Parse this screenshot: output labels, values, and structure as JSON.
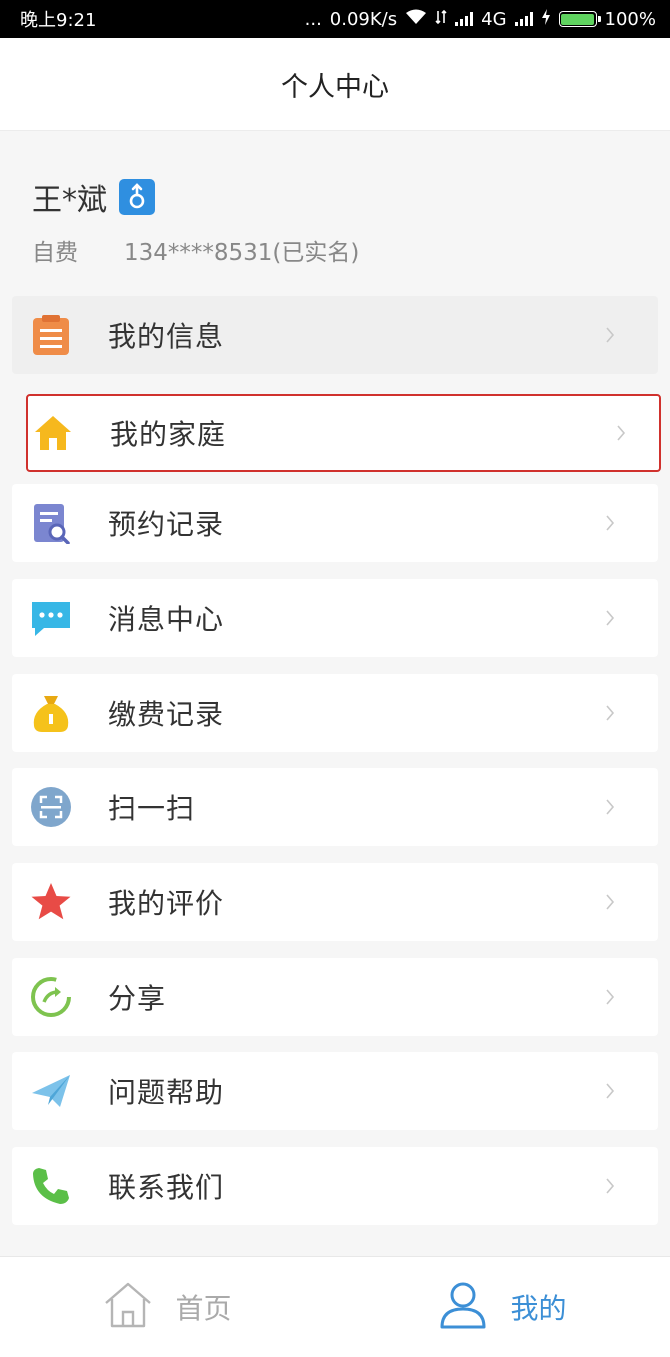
{
  "status_bar": {
    "time": "晚上9:21",
    "dots": "...",
    "speed": "0.09K/s",
    "network": "4G",
    "battery": "100%",
    "battery_level": 1.0
  },
  "header": {
    "title": "个人中心"
  },
  "profile": {
    "name": "王*斌",
    "gender_icon": "male-icon",
    "payment_type": "自费",
    "phone": "134****8531(已实名)"
  },
  "menu": {
    "items": [
      {
        "label": "我的信息",
        "icon": "clipboard-icon",
        "color": "#ef8c48"
      },
      {
        "label": "我的家庭",
        "icon": "house-icon",
        "color": "#f6b81d"
      },
      {
        "label": "预约记录",
        "icon": "document-search-icon",
        "color": "#7b86d0"
      },
      {
        "label": "消息中心",
        "icon": "chat-bubble-icon",
        "color": "#37b7e6"
      },
      {
        "label": "缴费记录",
        "icon": "money-bag-icon",
        "color": "#f5c21b"
      },
      {
        "label": "扫一扫",
        "icon": "scan-icon",
        "color": "#7fa6cc"
      },
      {
        "label": "我的评价",
        "icon": "star-icon",
        "color": "#e84b46"
      },
      {
        "label": "分享",
        "icon": "share-icon",
        "color": "#7ec34f"
      },
      {
        "label": "问题帮助",
        "icon": "paper-plane-icon",
        "color": "#7cc2ea"
      },
      {
        "label": "联系我们",
        "icon": "phone-icon",
        "color": "#5bbf48"
      }
    ]
  },
  "tab_bar": {
    "home": {
      "label": "首页",
      "icon": "home-icon"
    },
    "mine": {
      "label": "我的",
      "icon": "user-icon",
      "active": true
    }
  },
  "colors": {
    "accent": "#3c8fd6",
    "highlight_border": "#d0312d",
    "gender_badge": "#2f8fe0"
  }
}
